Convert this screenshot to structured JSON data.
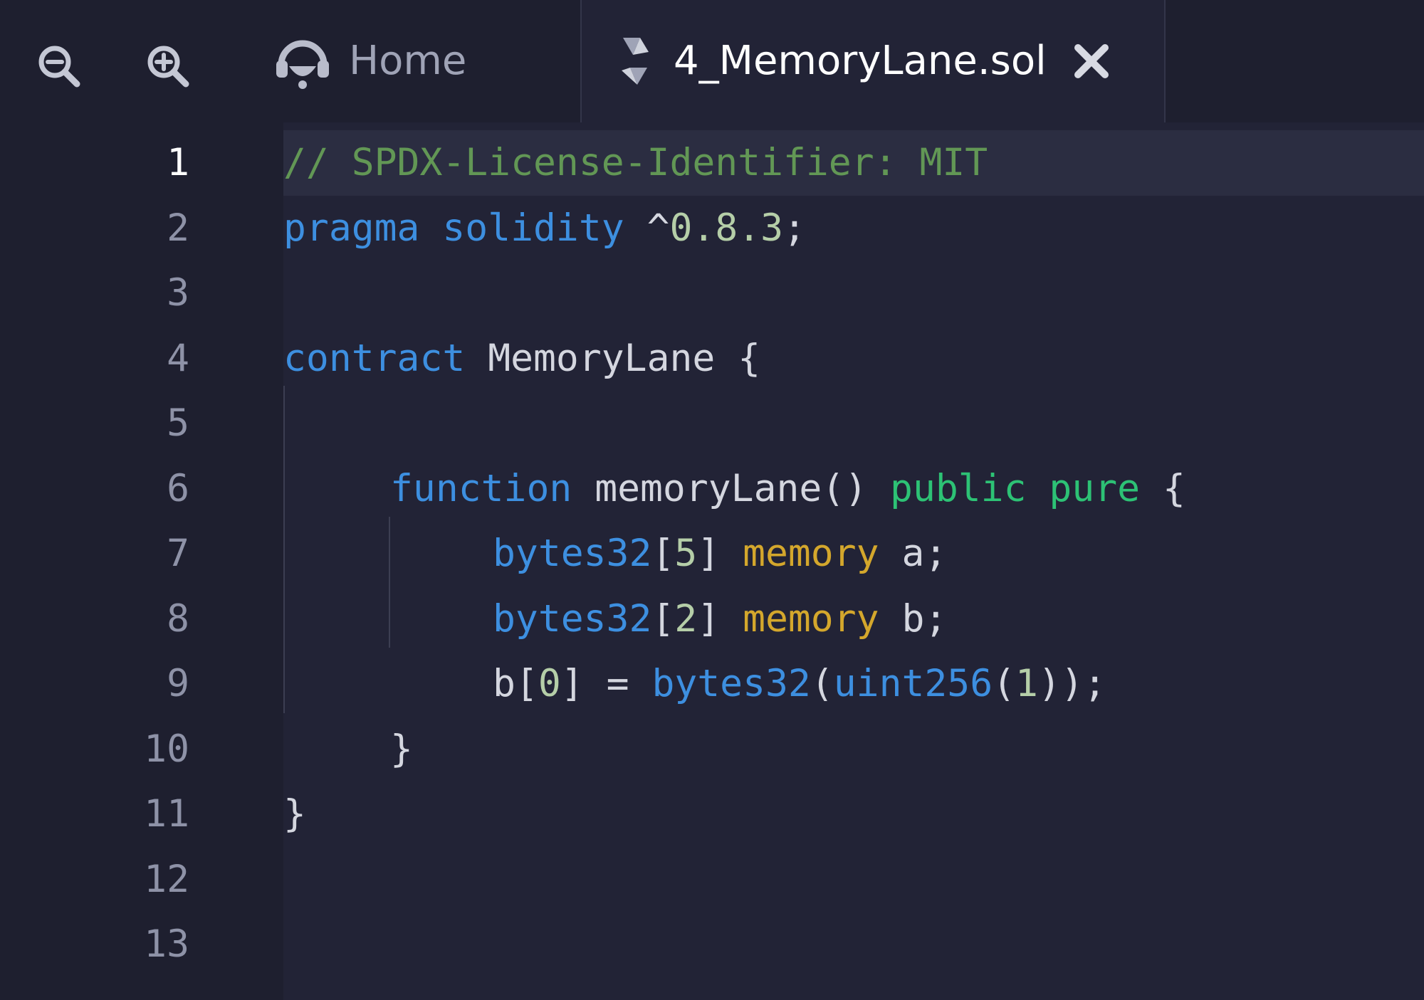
{
  "toolbar": {
    "zoom_out_icon": "zoom-out-icon",
    "zoom_in_icon": "zoom-in-icon"
  },
  "tabs": [
    {
      "label": "Home",
      "icon": "remix-logo-icon",
      "active": false
    },
    {
      "label": "4_MemoryLane.sol",
      "icon": "solidity-icon",
      "active": true,
      "close_icon": "close-icon"
    }
  ],
  "editor": {
    "active_line": 1,
    "line_numbers": [
      "1",
      "2",
      "3",
      "4",
      "5",
      "6",
      "7",
      "8",
      "9",
      "10",
      "11",
      "12",
      "13"
    ],
    "lines": {
      "l1": {
        "comment": "// SPDX-License-Identifier: MIT"
      },
      "l2": {
        "kw1": "pragma",
        "kw2": "solidity",
        "caret": "^",
        "version": "0.8.3",
        "semi": ";"
      },
      "l4": {
        "kw": "contract",
        "name": "MemoryLane",
        "brace": "{"
      },
      "l6": {
        "kw": "function",
        "name": "memoryLane()",
        "mod1": "public",
        "mod2": "pure",
        "brace": "{"
      },
      "l7": {
        "type": "bytes32",
        "lb": "[",
        "num": "5",
        "rb": "]",
        "mem": "memory",
        "var": "a;"
      },
      "l8": {
        "type": "bytes32",
        "lb": "[",
        "num": "2",
        "rb": "]",
        "mem": "memory",
        "var": "b;"
      },
      "l9": {
        "v": "b",
        "lb": "[",
        "num": "0",
        "rb": "]",
        "eq": "=",
        "fn1": "bytes32",
        "p1": "(",
        "fn2": "uint256",
        "p2": "(",
        "num2": "1",
        "close": "));"
      },
      "l10": {
        "brace": "}"
      },
      "l11": {
        "brace": "}"
      }
    }
  },
  "colors": {
    "comment": "#629755",
    "keyword": "#3d8fe0",
    "number": "#b5cea8",
    "modifier": "#2dc275",
    "memory": "#d4a72c",
    "background": "#222336"
  }
}
